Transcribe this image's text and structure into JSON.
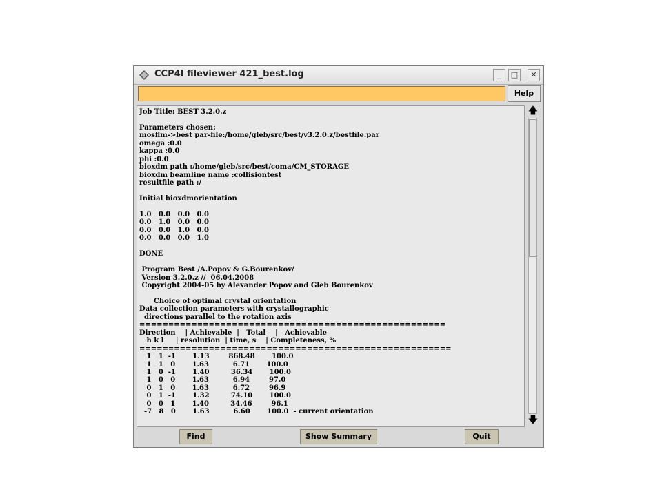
{
  "window": {
    "title": "CCP4I fileviewer 421_best.log",
    "controls": {
      "minimize": "_",
      "maximize": "□",
      "close": "✕"
    }
  },
  "toolbar": {
    "message": "",
    "help_label": "Help"
  },
  "log": {
    "lines": [
      "Job Title: BEST 3.2.0.z",
      "",
      "Parameters chosen:",
      "mosflm->best par-file:/home/gleb/src/best/v3.2.0.z/bestfile.par",
      "omega :0.0",
      "kappa :0.0",
      "phi :0.0",
      "bioxdm path :/home/gleb/src/best/coma/CM_STORAGE",
      "bioxdm beamline name :collisiontest",
      "resultfile path :/",
      "",
      "Initial bioxdmorientation",
      "",
      "1.0   0.0   0.0   0.0",
      "0.0   1.0   0.0   0.0",
      "0.0   0.0   1.0   0.0",
      "0.0   0.0   0.0   1.0",
      "",
      "DONE",
      "",
      " Program Best /A.Popov & G.Bourenkov/",
      " Version 3.2.0.z //  06.04.2008",
      " Copyright 2004-05 by Alexander Popov and Gleb Bourenkov",
      "",
      "      Choice of optimal crystal orientation",
      "Data collection parameters with crystallographic",
      "  directions parallel to the rotation axis",
      "=====================================================",
      "Direction    | Achievable  |   Total    |   Achievable",
      "   h k l     | resolution  | time, s    | Completeness, %",
      "======================================================",
      "   1   1  -1       1.13        868.48       100.0",
      "   1   1   0       1.63          6.71       100.0",
      "   1   0  -1       1.40         36.34       100.0",
      "   1   0   0       1.63          6.94        97.0",
      "   0   1   0       1.63          6.72        96.9",
      "   0   1  -1       1.32         74.10       100.0",
      "   0   0   1       1.40         34.46        96.1",
      "  -7   8   0       1.63          6.60       100.0  - current orientation"
    ]
  },
  "scrollbar": {
    "up_arrow": "🡅",
    "down_arrow": "🡇"
  },
  "buttons": {
    "find_label": "Find",
    "summary_label": "Show Summary",
    "quit_label": "Quit"
  }
}
